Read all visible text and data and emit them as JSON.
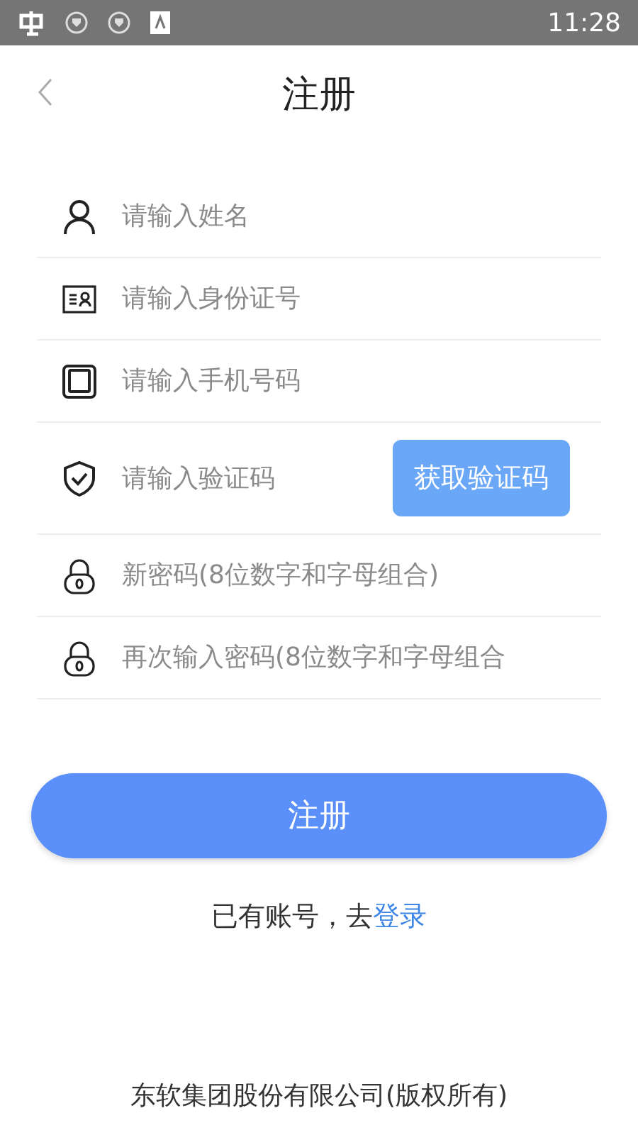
{
  "status_bar": {
    "time": "11:28"
  },
  "header": {
    "title": "注册"
  },
  "fields": [
    {
      "kind": "person",
      "placeholder": "请输入姓名"
    },
    {
      "kind": "id-card",
      "placeholder": "请输入身份证号"
    },
    {
      "kind": "phone",
      "placeholder": "请输入手机号码"
    },
    {
      "kind": "shield",
      "placeholder": "请输入验证码",
      "button": "获取验证码"
    },
    {
      "kind": "lock",
      "placeholder": "新密码(8位数字和字母组合)"
    },
    {
      "kind": "lock",
      "placeholder": "再次输入密码(8位数字和字母组合"
    }
  ],
  "submit": "注册",
  "login_prompt": {
    "text": "已有账号，去",
    "link": "登录"
  },
  "footer": "东软集团股份有限公司(版权所有)"
}
